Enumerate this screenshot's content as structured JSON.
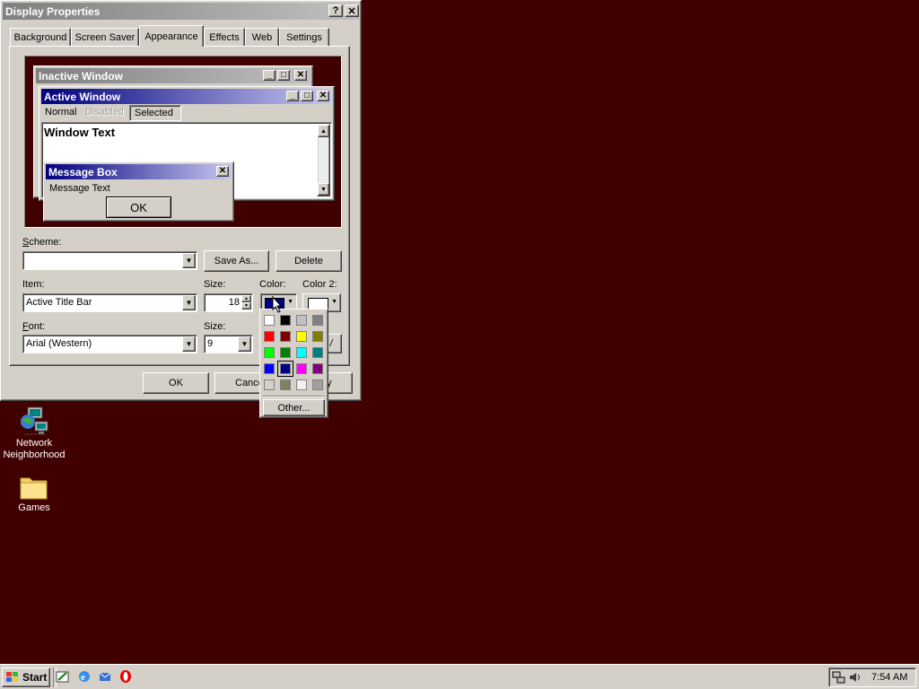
{
  "dialog": {
    "title": "Display Properties",
    "help_btn": "?",
    "close_btn": "✕",
    "tabs": [
      "Background",
      "Screen Saver",
      "Appearance",
      "Effects",
      "Web",
      "Settings"
    ],
    "active_tab": "Appearance",
    "ok_label": "OK",
    "cancel_label": "Cance",
    "apply_label": "y"
  },
  "preview": {
    "inactive_title": "Inactive Window",
    "active_title": "Active Window",
    "menu": {
      "normal": "Normal",
      "disabled": "Disabled",
      "selected": "Selected"
    },
    "window_text": "Window Text",
    "msgbox_title": "Message Box",
    "msgbox_text": "Message Text",
    "msgbox_ok": "OK"
  },
  "form": {
    "scheme_label": "Scheme:",
    "scheme_value": "",
    "save_as_label": "Save As...",
    "delete_label": "Delete",
    "item_label": "Item:",
    "item_value": "Active Title Bar",
    "size_label": "Size:",
    "size_value": "18",
    "color_label": "Color:",
    "color2_label": "Color 2:",
    "font_label": "Font:",
    "font_value": "Arial (Western)",
    "font_size_label": "Size:",
    "font_size_value": "9",
    "bold_partial": "/"
  },
  "palette": {
    "colors": [
      "#ffffff",
      "#000000",
      "#c0c0c0",
      "#808080",
      "#ff0000",
      "#800000",
      "#ffff00",
      "#808000",
      "#00ff00",
      "#008000",
      "#00ffff",
      "#008080",
      "#0000ff",
      "#000080",
      "#ff00ff",
      "#800080",
      "#d4d0c8",
      "#808060",
      "#f0f0f0",
      "#a0a0a0"
    ],
    "selected": "#000080",
    "other_label": "Other..."
  },
  "colors": {
    "desktop": "#400000",
    "active_title_start": "#000080",
    "active_title_end": "#c8c8f0",
    "inactive_title_start": "#808080",
    "inactive_title_end": "#c0c0c0",
    "color1_value": "#000080",
    "color2_value": "#ffffff"
  },
  "desktop": {
    "icons": [
      {
        "label": "Network Neighborhood",
        "icon": "network-icon"
      },
      {
        "label": "Games",
        "icon": "folder-icon"
      }
    ]
  },
  "taskbar": {
    "start_label": "Start",
    "quick_launch": [
      "show-desktop-icon",
      "internet-explorer-icon",
      "outlook-express-icon",
      "opera-icon"
    ],
    "tray_icons": [
      "network-tray-icon",
      "volume-tray-icon"
    ],
    "time": "7:54 AM"
  }
}
